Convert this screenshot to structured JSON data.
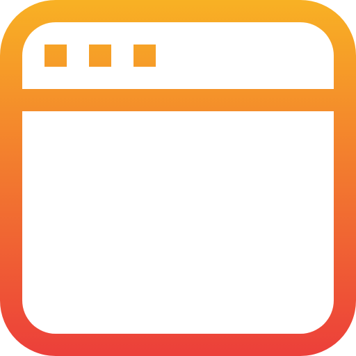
{
  "icon": {
    "name": "browser-window-icon",
    "gradient": {
      "top_color": "#F8B124",
      "bottom_color": "#EC3F3A"
    },
    "window_buttons": [
      "dot",
      "dot",
      "dot"
    ]
  }
}
